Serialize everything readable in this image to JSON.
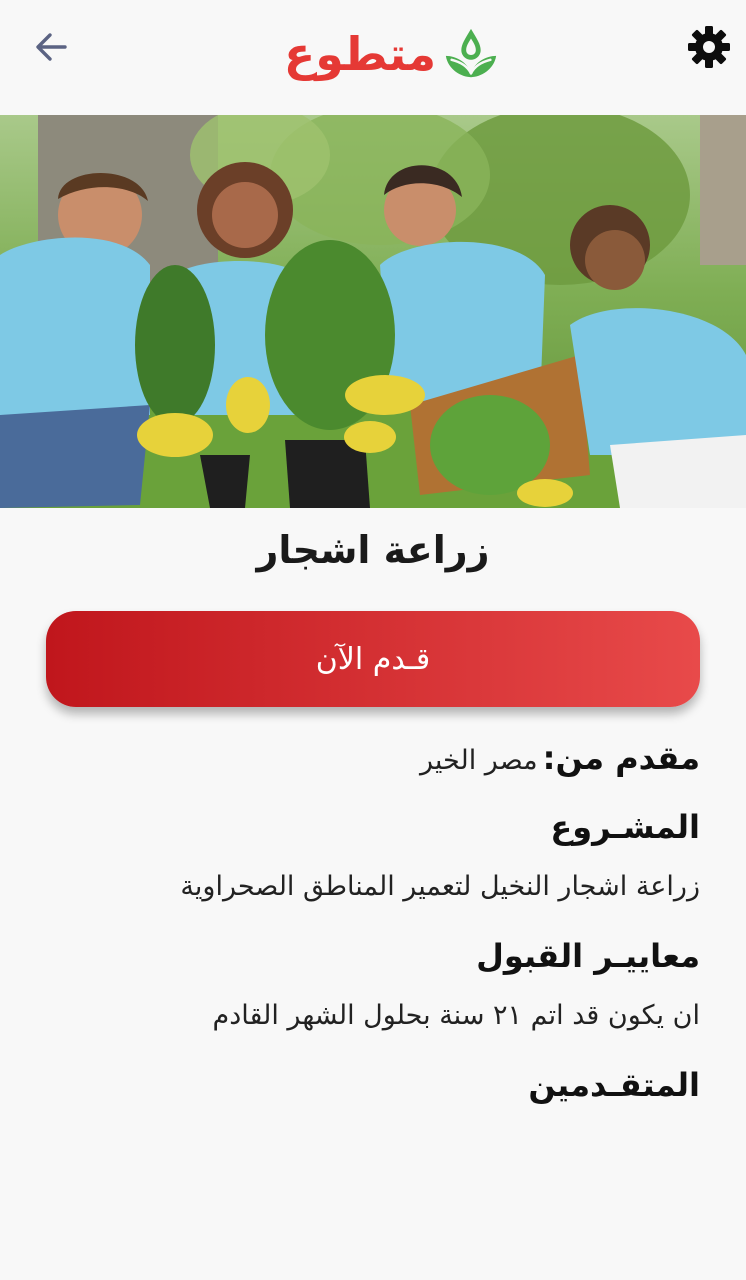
{
  "header": {
    "back_icon": "arrow-left-icon",
    "settings_icon": "gear-icon",
    "logo_text": "متطوع",
    "logo_icon": "sprout-drop-icon"
  },
  "hero": {
    "image": "volunteers-planting-trees-photo"
  },
  "opportunity": {
    "title": "زراعة اشجار",
    "apply_label": "قـدم الآن",
    "provider_label": "مقدم من:",
    "provider_value": "مصر الخير",
    "project_label": "المشـروع",
    "project_value": "زراعة اشجار النخيل لتعمير المناطق الصحراوية",
    "criteria_label": "معاييـر القبول",
    "criteria_value": "ان يكون قد اتم ٢١ سنة بحلول الشهر القادم",
    "applicants_label": "المتقـدمين"
  },
  "colors": {
    "brand_red": "#e53935",
    "brand_green": "#4caf50",
    "button_start": "#c0161c",
    "button_end": "#e84a4a",
    "background": "#f8f8f8"
  }
}
